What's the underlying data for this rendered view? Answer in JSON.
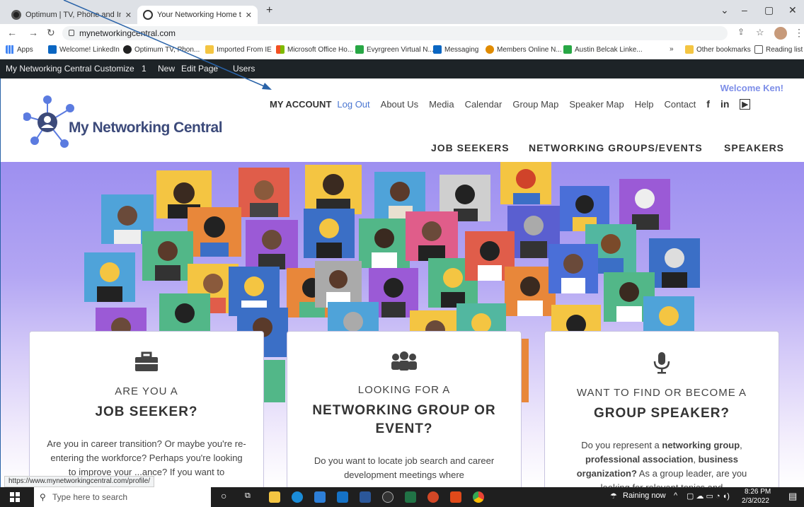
{
  "browser": {
    "tabs": [
      {
        "title": "Optimum | TV, Phone and Interne",
        "close": "✕"
      },
      {
        "title": "Your Networking Home to find Jo",
        "close": "✕"
      }
    ],
    "new_tab": "+",
    "window_controls": [
      "⌄",
      "–",
      "▢",
      "✕"
    ],
    "url": "mynetworkingcentral.com",
    "bookmarks": [
      "Apps",
      "Welcome! LinkedIn",
      "Optimum TV, Phon...",
      "Imported From IE",
      "Microsoft Office Ho...",
      "Evyrgreen Virtual N...",
      "Messaging",
      "Members Online N...",
      "Austin Belcak Linke..."
    ],
    "bookmarks_more": "»",
    "other_bookmarks": "Other bookmarks",
    "reading_list": "Reading list"
  },
  "admin_bar": {
    "items": [
      "My Networking Central",
      "Customize",
      "1",
      "New",
      "Edit Page",
      "Users"
    ]
  },
  "header": {
    "welcome": "Welcome Ken!",
    "my_account": "MY ACCOUNT",
    "logout": "Log Out",
    "links": [
      "About Us",
      "Media",
      "Calendar",
      "Group Map",
      "Speaker Map",
      "Help",
      "Contact"
    ],
    "social": [
      "f",
      "in"
    ],
    "logo_text": "My Networking Central",
    "main_nav": [
      "JOB SEEKERS",
      "NETWORKING GROUPS/EVENTS",
      "SPEAKERS"
    ]
  },
  "cards": [
    {
      "icon": "briefcase-icon",
      "pre": "ARE YOU A",
      "big": "JOB SEEKER?",
      "body": "Are you in career transition? Or maybe you're re-entering the workforce? Perhaps you're looking to improve your ...ance? If you want to"
    },
    {
      "icon": "group-icon",
      "pre": "LOOKING FOR A",
      "big": "NETWORKING GROUP OR EVENT?",
      "body": "Do you want to locate job search and career development meetings where"
    },
    {
      "icon": "microphone-icon",
      "pre": "WANT TO FIND OR BECOME A",
      "big": "GROUP SPEAKER?",
      "body_parts": [
        "Do you represent a ",
        "networking group",
        ", ",
        "professional association",
        ", ",
        "business organization?",
        " As a group leader, are you looking for relevant topics and"
      ]
    }
  ],
  "status_url": "https://www.mynetworkingcentral.com/profile/",
  "taskbar": {
    "search_placeholder": "Type here to search",
    "weather": "Raining now",
    "time": "8:26 PM",
    "date": "2/3/2022"
  },
  "colors": {
    "accent": "#4a76d1",
    "welcome": "#7d8ee8",
    "admin_bar": "#1d2327",
    "hero_top": "#9d8ff0"
  }
}
